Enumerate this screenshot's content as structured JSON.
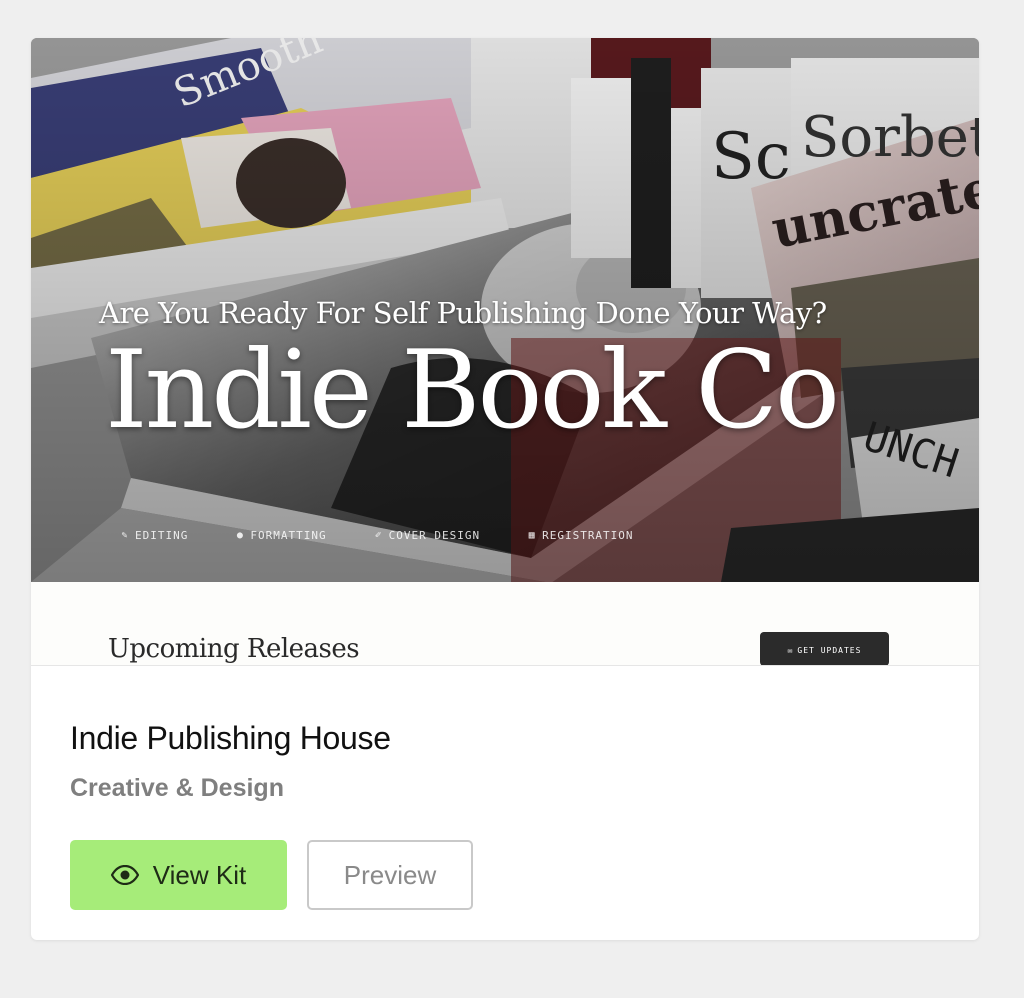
{
  "preview": {
    "tagline": "Are You Ready For Self Publishing Done Your Way?",
    "brand_title": "Indie Book Co",
    "nav": [
      {
        "icon": "edit-icon",
        "glyph": "✎",
        "label": "EDITING"
      },
      {
        "icon": "lightbulb-icon",
        "glyph": "●",
        "label": "FORMATTING"
      },
      {
        "icon": "brush-icon",
        "glyph": "✐",
        "label": "COVER DESIGN"
      },
      {
        "icon": "registration-icon",
        "glyph": "▦",
        "label": "REGISTRATION"
      }
    ],
    "section_title": "Upcoming Releases",
    "updates_button": {
      "icon": "mail-icon",
      "glyph": "✉",
      "label": "GET UPDATES"
    }
  },
  "card": {
    "title": "Indie Publishing House",
    "category": "Creative & Design",
    "view_kit_label": "View Kit",
    "view_kit_icon": "eye-icon",
    "preview_label": "Preview"
  },
  "colors": {
    "page_background": "#efefef",
    "card_background": "#ffffff",
    "view_kit_button": "#a6ec79",
    "preview_border": "#c9c9c9",
    "category_text": "#7f7f7f",
    "updates_button": "#2b2b2b"
  }
}
